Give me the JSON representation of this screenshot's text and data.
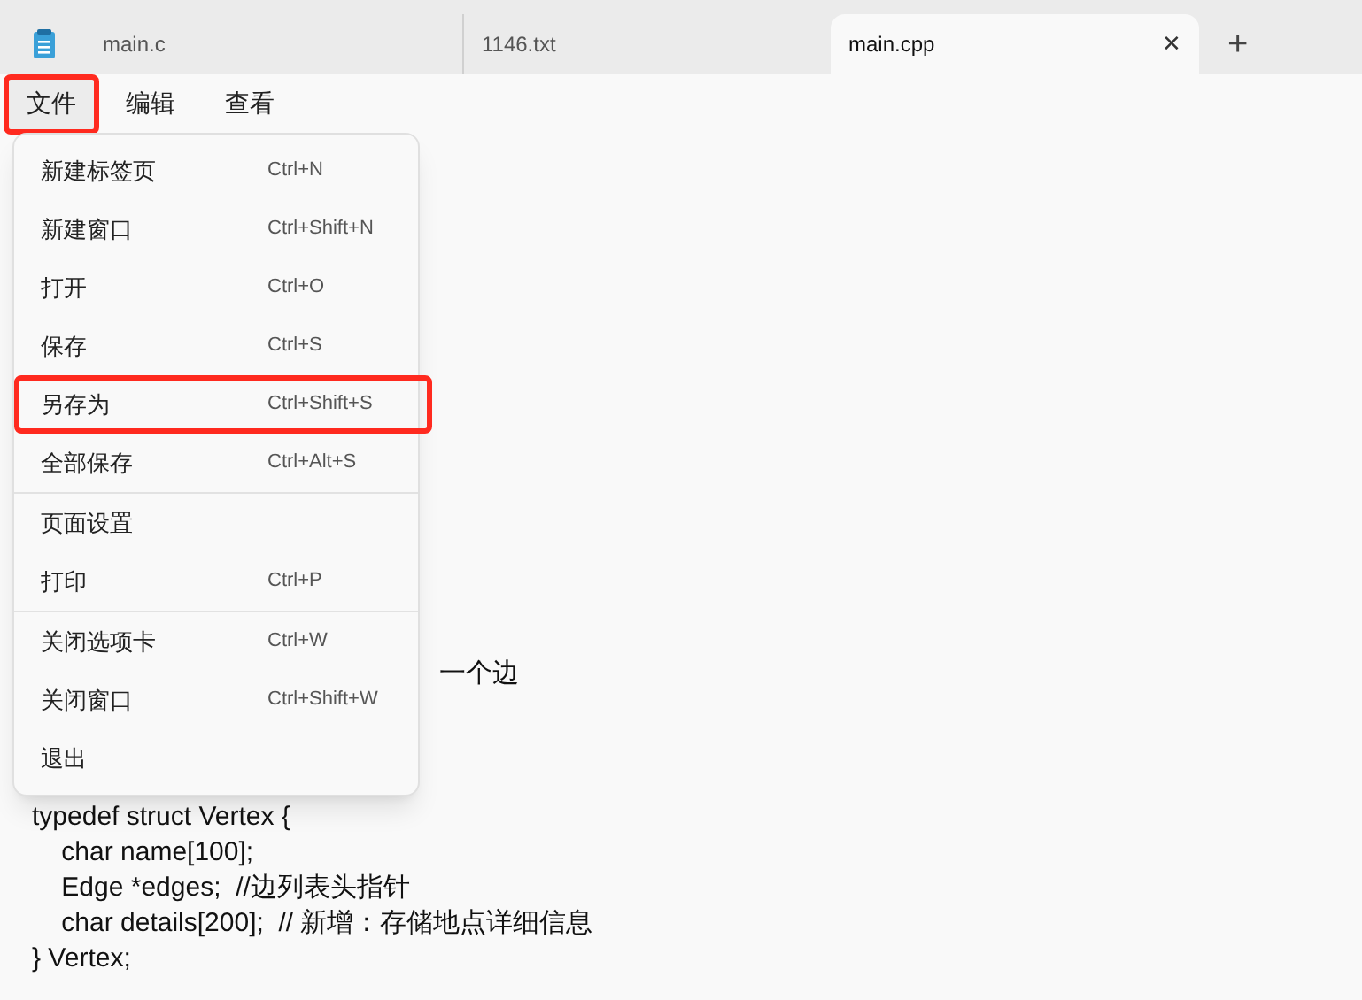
{
  "tabs": [
    {
      "label": "main.c",
      "selected": false,
      "icon": true
    },
    {
      "label": "1146.txt",
      "selected": false,
      "icon": false
    },
    {
      "label": "main.cpp",
      "selected": true,
      "icon": false
    }
  ],
  "close_tab": "✕",
  "new_tab": "+",
  "menu_bar": [
    {
      "label": "文件",
      "selected": true,
      "highlighted": true
    },
    {
      "label": "编辑",
      "selected": false,
      "highlighted": false
    },
    {
      "label": "查看",
      "selected": false,
      "highlighted": false
    }
  ],
  "file_menu": {
    "groups": [
      [
        {
          "label": "新建标签页",
          "shortcut": "Ctrl+N",
          "highlighted": false
        },
        {
          "label": "新建窗口",
          "shortcut": "Ctrl+Shift+N",
          "highlighted": false
        },
        {
          "label": "打开",
          "shortcut": "Ctrl+O",
          "highlighted": false
        },
        {
          "label": "保存",
          "shortcut": "Ctrl+S",
          "highlighted": false
        },
        {
          "label": "另存为",
          "shortcut": "Ctrl+Shift+S",
          "highlighted": true
        },
        {
          "label": "全部保存",
          "shortcut": "Ctrl+Alt+S",
          "highlighted": false
        }
      ],
      [
        {
          "label": "页面设置",
          "highlighted": false
        },
        {
          "label": "打印",
          "shortcut": "Ctrl+P",
          "highlighted": false
        }
      ],
      [
        {
          "label": "关闭选项卡",
          "shortcut": "Ctrl+W",
          "highlighted": false
        },
        {
          "label": "关闭窗口",
          "shortcut": "Ctrl+Shift+W",
          "highlighted": false
        },
        {
          "label": "退出",
          "highlighted": false
        }
      ]
    ]
  },
  "editor": {
    "partial_line": "一个边",
    "lines": [
      "typedef struct Vertex {",
      "    char name[100];",
      "    Edge *edges;  //边列表头指针",
      "    char details[200];  // 新增：存储地点详细信息",
      "} Vertex;"
    ]
  }
}
